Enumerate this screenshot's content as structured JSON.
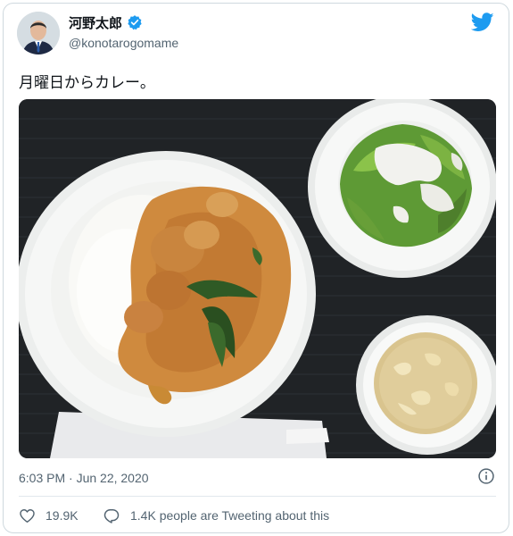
{
  "tweet": {
    "author": {
      "display_name": "河野太郎",
      "handle": "@konotarogomame",
      "verified": true,
      "avatar_icon": "user-avatar"
    },
    "brand_icon": "twitter-bird-icon",
    "text": "月曜日からカレー。",
    "media_icon": "food-photo",
    "timestamp": "6:03 PM · Jun 22, 2020",
    "info_icon": "info-icon",
    "likes": "19.9K",
    "replies_text": "1.4K people are Tweeting about this"
  },
  "colors": {
    "brand": "#1d9bf0",
    "text_primary": "#0f1419",
    "text_secondary": "#536471",
    "border": "#cfd9de"
  }
}
